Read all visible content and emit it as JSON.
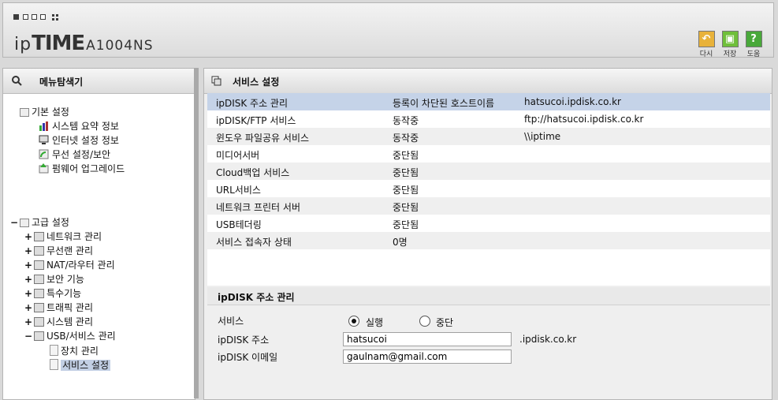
{
  "header": {
    "brand_prefix": "ip",
    "brand_name": "TIME",
    "model": "A1004NS",
    "buttons": [
      {
        "label": "다시",
        "icon": "undo-icon",
        "color": "#e8b23a",
        "glyph": "↶"
      },
      {
        "label": "저장",
        "icon": "save-icon",
        "color": "#6fbf3a",
        "glyph": "▣"
      },
      {
        "label": "도움",
        "icon": "help-icon",
        "color": "#49a83a",
        "glyph": "?"
      }
    ]
  },
  "sidebar": {
    "title": "메뉴탐색기",
    "basic": {
      "label": "기본 설정",
      "items": [
        "시스템 요약 정보",
        "인터넷 설정 정보",
        "무선 설정/보안",
        "펌웨어 업그레이드"
      ]
    },
    "advanced": {
      "expander": "−",
      "label": "고급 설정",
      "items": [
        {
          "expander": "+",
          "label": "네트워크 관리"
        },
        {
          "expander": "+",
          "label": "무선랜 관리"
        },
        {
          "expander": "+",
          "label": "NAT/라우터 관리"
        },
        {
          "expander": "+",
          "label": "보안 기능"
        },
        {
          "expander": "+",
          "label": "특수기능"
        },
        {
          "expander": "+",
          "label": "트래픽 관리"
        },
        {
          "expander": "+",
          "label": "시스템 관리"
        },
        {
          "expander": "−",
          "label": "USB/서비스 관리"
        }
      ],
      "usb_children": [
        "장치 관리",
        "서비스 설정"
      ]
    }
  },
  "main": {
    "title": "서비스 설정",
    "rows": [
      {
        "name": "ipDISK 주소 관리",
        "status": "등록이 차단된 호스트이름",
        "value": "hatsucoi.ipdisk.co.kr"
      },
      {
        "name": "ipDISK/FTP 서비스",
        "status": "동작중",
        "value": "ftp://hatsucoi.ipdisk.co.kr"
      },
      {
        "name": "윈도우 파일공유 서비스",
        "status": "동작중",
        "value": "\\\\iptime"
      },
      {
        "name": "미디어서버",
        "status": "중단됨",
        "value": ""
      },
      {
        "name": "Cloud백업 서비스",
        "status": "중단됨",
        "value": ""
      },
      {
        "name": "URL서비스",
        "status": "중단됨",
        "value": ""
      },
      {
        "name": "네트워크 프린터 서버",
        "status": "중단됨",
        "value": ""
      },
      {
        "name": "USB테더링",
        "status": "중단됨",
        "value": ""
      },
      {
        "name": "서비스 접속자 상태",
        "status": "0명",
        "value": ""
      }
    ],
    "ipdisk": {
      "section_title": "ipDISK 주소 관리",
      "service_label": "서비스",
      "radio_on": "실행",
      "radio_off": "중단",
      "address_label": "ipDISK 주소",
      "address_value": "hatsucoi",
      "address_suffix": ".ipdisk.co.kr",
      "email_label": "ipDISK 이메일",
      "email_value": "gaulnam@gmail.com"
    }
  }
}
